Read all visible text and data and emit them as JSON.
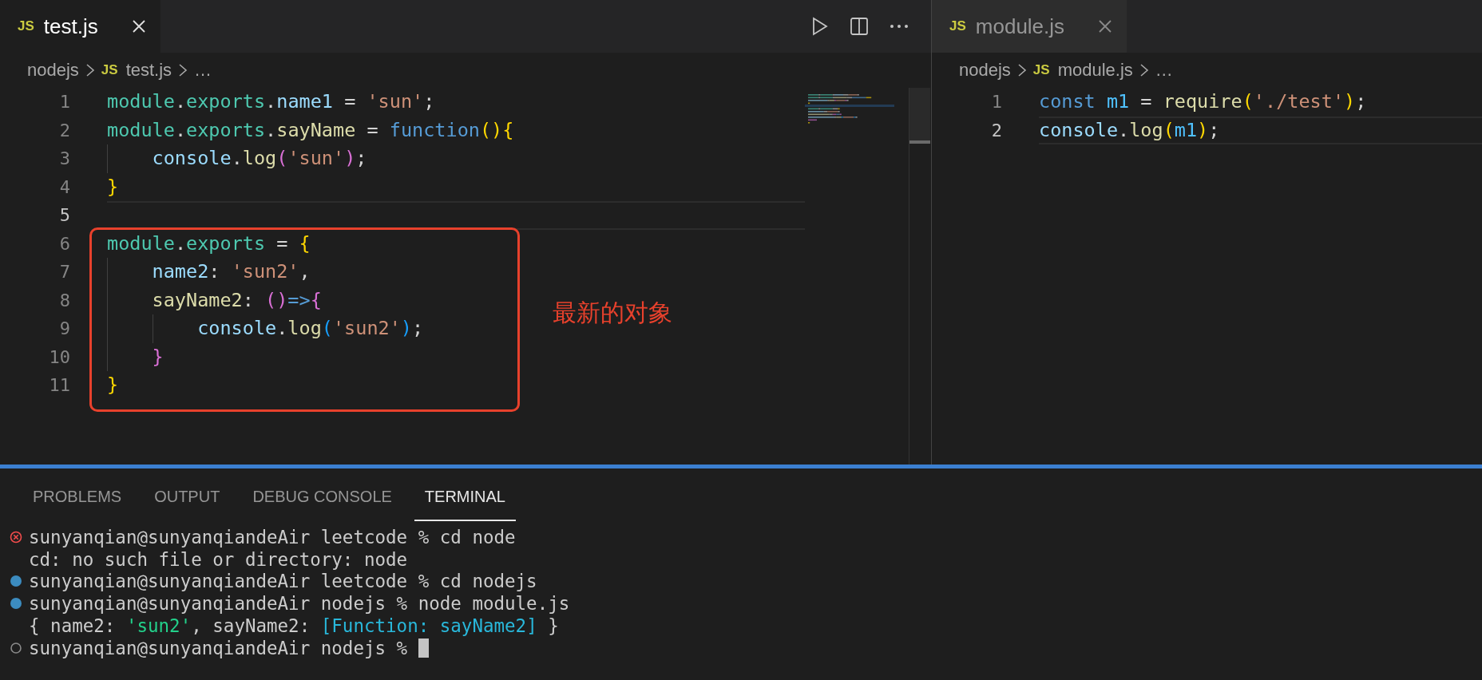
{
  "editors": [
    {
      "tab": {
        "icon": "JS",
        "label": "test.js",
        "selected": true
      },
      "actions": [
        {
          "kind": "run"
        },
        {
          "kind": "split"
        },
        {
          "kind": "more"
        }
      ],
      "minimap": true,
      "breadcrumbs": [
        {
          "text": "nodejs",
          "kind": "folder"
        },
        {
          "icon": "JS",
          "text": "test.js",
          "kind": "file"
        },
        {
          "text": "…",
          "kind": "more"
        }
      ],
      "lines": [
        {
          "number": "1",
          "current": false,
          "boxed": false,
          "tokens": [
            {
              "text": "module",
              "kind": "object"
            },
            {
              "text": ".",
              "kind": "punct"
            },
            {
              "text": "exports",
              "kind": "object"
            },
            {
              "text": ".",
              "kind": "punct"
            },
            {
              "text": "name1",
              "kind": "property"
            },
            {
              "text": " = ",
              "kind": "punct"
            },
            {
              "text": "'sun'",
              "kind": "string"
            },
            {
              "text": ";",
              "kind": "punct"
            }
          ]
        },
        {
          "number": "2",
          "current": false,
          "boxed": false,
          "tokens": [
            {
              "text": "module",
              "kind": "object"
            },
            {
              "text": ".",
              "kind": "punct"
            },
            {
              "text": "exports",
              "kind": "object"
            },
            {
              "text": ".",
              "kind": "punct"
            },
            {
              "text": "sayName",
              "kind": "function"
            },
            {
              "text": " = ",
              "kind": "punct"
            },
            {
              "text": "function",
              "kind": "keyword"
            },
            {
              "text": "(){",
              "kind": "bracket1"
            }
          ]
        },
        {
          "number": "3",
          "current": false,
          "boxed": false,
          "tokens": [
            {
              "text": "    console",
              "kind": "property"
            },
            {
              "text": ".",
              "kind": "punct"
            },
            {
              "text": "log",
              "kind": "function"
            },
            {
              "text": "(",
              "kind": "bracket2"
            },
            {
              "text": "'sun'",
              "kind": "string"
            },
            {
              "text": ")",
              "kind": "bracket2"
            },
            {
              "text": ";",
              "kind": "punct"
            }
          ]
        },
        {
          "number": "4",
          "current": false,
          "boxed": false,
          "tokens": [
            {
              "text": "}",
              "kind": "bracket1"
            }
          ]
        },
        {
          "number": "5",
          "current": true,
          "boxed": false
        },
        {
          "number": "6",
          "current": false,
          "boxed": true,
          "tokens": [
            {
              "text": "module",
              "kind": "object"
            },
            {
              "text": ".",
              "kind": "punct"
            },
            {
              "text": "exports",
              "kind": "object"
            },
            {
              "text": " = ",
              "kind": "punct"
            },
            {
              "text": "{",
              "kind": "bracket1"
            }
          ]
        },
        {
          "number": "7",
          "current": false,
          "boxed": true,
          "tokens": [
            {
              "text": "    name2",
              "kind": "property"
            },
            {
              "text": ": ",
              "kind": "punct"
            },
            {
              "text": "'sun2'",
              "kind": "string"
            },
            {
              "text": ",",
              "kind": "punct"
            }
          ]
        },
        {
          "number": "8",
          "current": false,
          "boxed": true,
          "tokens": [
            {
              "text": "    sayName2",
              "kind": "function"
            },
            {
              "text": ": ",
              "kind": "punct"
            },
            {
              "text": "()",
              "kind": "bracket2"
            },
            {
              "text": "=>",
              "kind": "keyword"
            },
            {
              "text": "{",
              "kind": "bracket2"
            }
          ]
        },
        {
          "number": "9",
          "current": false,
          "boxed": true,
          "tokens": [
            {
              "text": "        console",
              "kind": "property"
            },
            {
              "text": ".",
              "kind": "punct"
            },
            {
              "text": "log",
              "kind": "function"
            },
            {
              "text": "(",
              "kind": "bracket3"
            },
            {
              "text": "'sun2'",
              "kind": "string"
            },
            {
              "text": ")",
              "kind": "bracket3"
            },
            {
              "text": ";",
              "kind": "punct"
            }
          ]
        },
        {
          "number": "10",
          "current": false,
          "boxed": true,
          "tokens": [
            {
              "text": "    }",
              "kind": "bracket2"
            }
          ]
        },
        {
          "number": "11",
          "current": false,
          "boxed": true,
          "tokens": [
            {
              "text": "}",
              "kind": "bracket1"
            }
          ]
        }
      ],
      "annotation": {
        "text": "最新的对象"
      }
    },
    {
      "tab": {
        "icon": "JS",
        "label": "module.js",
        "selected": false
      },
      "minimap": false,
      "breadcrumbs": [
        {
          "text": "nodejs",
          "kind": "folder"
        },
        {
          "icon": "JS",
          "text": "module.js",
          "kind": "file"
        },
        {
          "text": "…",
          "kind": "more"
        }
      ],
      "lines": [
        {
          "number": "1",
          "current": false,
          "tokens": [
            {
              "text": "const",
              "kind": "keyword"
            },
            {
              "text": " m1",
              "kind": "constant"
            },
            {
              "text": " = ",
              "kind": "punct"
            },
            {
              "text": "require",
              "kind": "function"
            },
            {
              "text": "(",
              "kind": "bracket1"
            },
            {
              "text": "'./test'",
              "kind": "string"
            },
            {
              "text": ")",
              "kind": "bracket1"
            },
            {
              "text": ";",
              "kind": "punct"
            }
          ]
        },
        {
          "number": "2",
          "current": true,
          "tokens": [
            {
              "text": "console",
              "kind": "property"
            },
            {
              "text": ".",
              "kind": "punct"
            },
            {
              "text": "log",
              "kind": "function"
            },
            {
              "text": "(",
              "kind": "bracket1"
            },
            {
              "text": "m1",
              "kind": "constant"
            },
            {
              "text": ")",
              "kind": "bracket1"
            },
            {
              "text": ";",
              "kind": "punct"
            }
          ]
        }
      ]
    }
  ],
  "panel": {
    "tabs": [
      {
        "label": "PROBLEMS",
        "selected": false
      },
      {
        "label": "OUTPUT",
        "selected": false
      },
      {
        "label": "DEBUG CONSOLE",
        "selected": false
      },
      {
        "label": "TERMINAL",
        "selected": true
      }
    ],
    "terminal": [
      {
        "kind": "error",
        "cursor": false,
        "tokens": [
          {
            "text": "sunyanqian@sunyanqiandeAir leetcode % cd node",
            "kind": "plain"
          }
        ]
      },
      {
        "kind": "output",
        "cursor": false,
        "tokens": [
          {
            "text": "cd: no such file or directory: node",
            "kind": "plain"
          }
        ]
      },
      {
        "kind": "success",
        "cursor": false,
        "tokens": [
          {
            "text": "sunyanqian@sunyanqiandeAir leetcode % cd nodejs",
            "kind": "plain"
          }
        ]
      },
      {
        "kind": "success",
        "cursor": false,
        "tokens": [
          {
            "text": "sunyanqian@sunyanqiandeAir nodejs % node module.js",
            "kind": "plain"
          }
        ]
      },
      {
        "kind": "output",
        "cursor": false,
        "tokens": [
          {
            "text": "{ name2: ",
            "kind": "plain"
          },
          {
            "text": "'sun2'",
            "kind": "string"
          },
          {
            "text": ", sayName2: ",
            "kind": "plain"
          },
          {
            "text": "[Function: sayName2]",
            "kind": "special"
          },
          {
            "text": " }",
            "kind": "plain"
          }
        ]
      },
      {
        "kind": "idle",
        "cursor": true,
        "tokens": [
          {
            "text": "sunyanqian@sunyanqiandeAir nodejs %",
            "kind": "plain"
          }
        ]
      }
    ]
  }
}
